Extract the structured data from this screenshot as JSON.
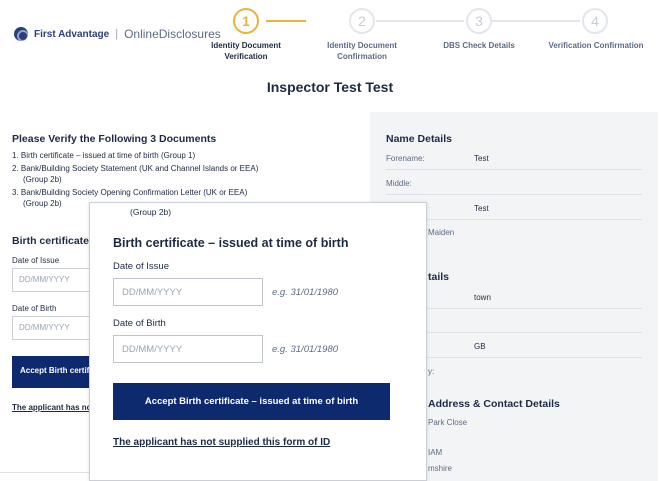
{
  "header": {
    "brand": "First Advantage",
    "separator": "|",
    "product": "OnlineDisclosures"
  },
  "stepper": {
    "steps": [
      {
        "number": "1",
        "label_line1": "Identity Document",
        "label_line2": "Verification",
        "active": true
      },
      {
        "number": "2",
        "label_line1": "Identity Document",
        "label_line2": "Confirmation",
        "active": false
      },
      {
        "number": "3",
        "label_line1": "DBS Check Details",
        "label_line2": "",
        "active": false
      },
      {
        "number": "4",
        "label_line1": "Verification Confirmation",
        "label_line2": "",
        "active": false
      }
    ]
  },
  "page_title": "Inspector Test Test",
  "left": {
    "heading": "Please Verify the Following 3 Documents",
    "documents": [
      {
        "line1": "1. Birth certificate – issued at time of birth (Group 1)",
        "line2": ""
      },
      {
        "line1": "2. Bank/Building Society Statement (UK and Channel Islands or EEA)",
        "line2": "(Group 2b)"
      },
      {
        "line1": "3. Bank/Building Society Opening Confirmation Letter (UK or EEA)",
        "line2": "(Group 2b)"
      }
    ],
    "section_title": "Birth certificate",
    "date_issue_label": "Date of Issue",
    "date_issue_placeholder": "DD/MM/YYYY",
    "dob_label": "Date of Birth",
    "dob_placeholder": "DD/MM/YYYY",
    "accept_button": "Accept Birth certificate",
    "not_supplied_link": "The applicant has not supplied this form of ID"
  },
  "right_panel": {
    "name_title": "Name Details",
    "forename_label": "Forename:",
    "forename_value": "Test",
    "middle_label": "Middle:",
    "surname_value": "Test",
    "maiden_partial": "Maiden",
    "details_partial": "tails",
    "town_value": "town",
    "country_value": "GB",
    "partial_colon": "y:",
    "address_title": "Address & Contact Details",
    "address_line1": "Park Close",
    "address_line2": "IAM",
    "address_line3": "mshire"
  },
  "modal": {
    "top_note": "(Group 2b)",
    "title": "Birth certificate – issued at time of birth",
    "date_issue_label": "Date of Issue",
    "date_issue_placeholder": "DD/MM/YYYY",
    "date_issue_hint": "e.g. 31/01/1980",
    "dob_label": "Date of Birth",
    "dob_placeholder": "DD/MM/YYYY",
    "dob_hint": "e.g. 31/01/1980",
    "accept_button": "Accept Birth certificate – issued at time of birth",
    "not_supplied_link": "The applicant has not supplied this form of ID"
  },
  "colors": {
    "primary": "#0e2a6e",
    "accent": "#e8b53a",
    "panel_bg": "#f3f4f6",
    "text": "#1d2a44"
  }
}
